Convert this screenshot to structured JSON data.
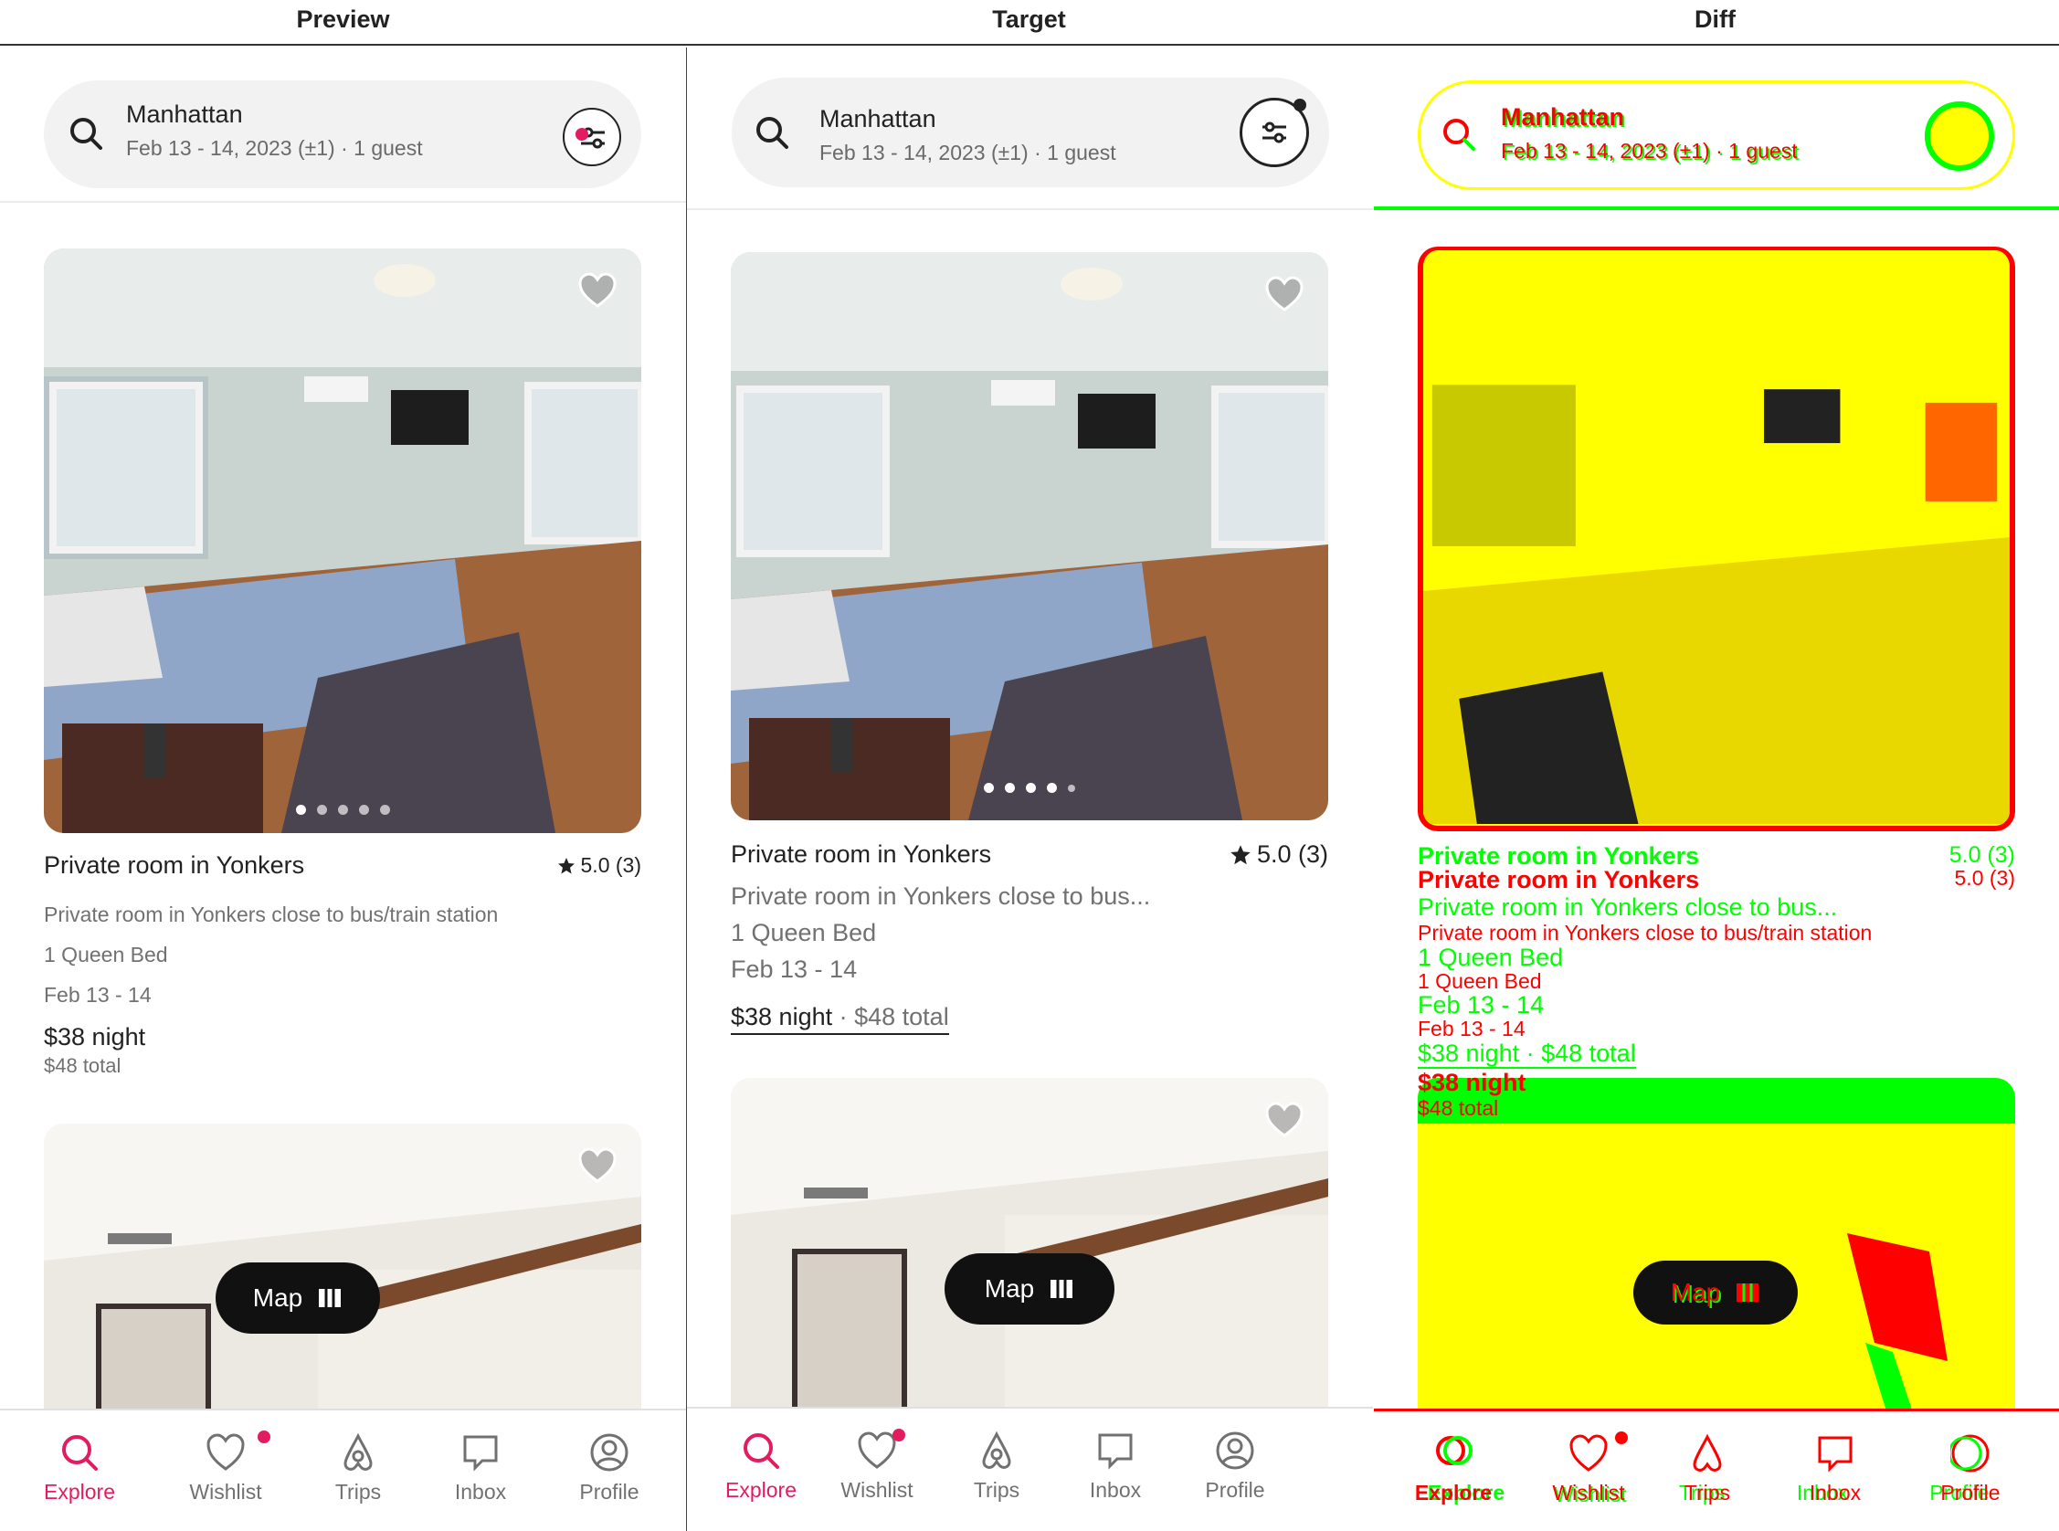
{
  "columns": {
    "preview": "Preview",
    "target": "Target",
    "diff": "Diff"
  },
  "search": {
    "location": "Manhattan",
    "details": "Feb 13 - 14, 2023 (±1) · 1 guest"
  },
  "listing": {
    "title": "Private room in Yonkers",
    "rating": "5.0 (3)",
    "description_full": "Private room in  Yonkers close to bus/train station",
    "description_short": "Private room in  Yonkers close to bus...",
    "beds": "1 Queen Bed",
    "dates": "Feb 13 - 14",
    "price_night": "$38 night",
    "price_total": "$48 total",
    "price_combined_night": "$38 night",
    "price_combined_sep": " · ",
    "price_combined_total": "$48 total",
    "photo_count": 5
  },
  "map_button": {
    "label": "Map"
  },
  "nav": [
    {
      "label": "Explore",
      "icon": "search-icon",
      "active": true
    },
    {
      "label": "Wishlist",
      "icon": "heart-icon",
      "active": false,
      "badge": true
    },
    {
      "label": "Trips",
      "icon": "airbnb-logo-icon",
      "active": false
    },
    {
      "label": "Inbox",
      "icon": "message-icon",
      "active": false
    },
    {
      "label": "Profile",
      "icon": "profile-icon",
      "active": false
    }
  ],
  "colors": {
    "accent": "#e31c5f",
    "diff_add": "#00ff00",
    "diff_remove": "#ff0000",
    "diff_match": "#ffff00"
  }
}
